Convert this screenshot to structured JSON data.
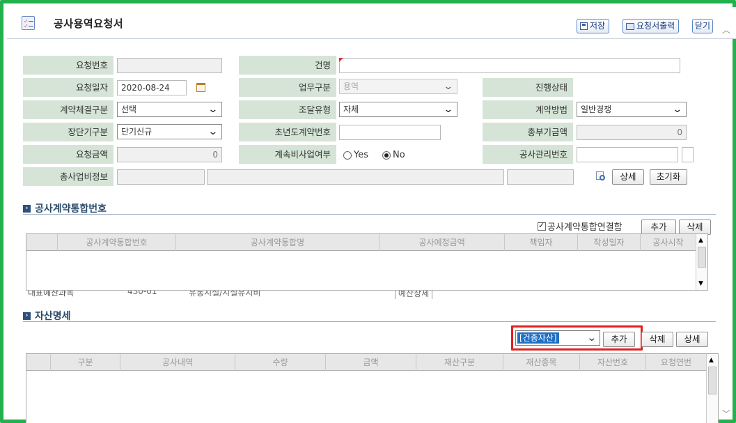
{
  "header": {
    "title": "공사용역요청서",
    "save_label": "저장",
    "print_label": "요청서출력",
    "close_label": "닫기"
  },
  "form": {
    "request_no_label": "요청번호",
    "request_no_value": "",
    "case_name_label": "건명",
    "case_name_value": "",
    "request_date_label": "요청일자",
    "request_date_value": "2020-08-24",
    "work_type_label": "업무구분",
    "work_type_value": "용역",
    "progress_label": "진행상태",
    "progress_value": "",
    "contract_method_group_label": "계약체결구분",
    "contract_method_group_value": "선택",
    "procure_type_label": "조달유형",
    "procure_type_value": "자체",
    "contract_method_label": "계약방법",
    "contract_method_value": "일반경쟁",
    "term_type_label": "장단기구분",
    "term_type_value": "단기신규",
    "first_year_no_label": "초년도계약번호",
    "first_year_no_value": "",
    "total_amount_label": "총부기금액",
    "total_amount_value": "0",
    "request_amount_label": "요청금액",
    "request_amount_value": "0",
    "continuing_label": "계속비사업여부",
    "continuing_yes": "Yes",
    "continuing_no": "No",
    "continuing_selected": "No",
    "mgmt_no_label": "공사관리번호",
    "mgmt_no_value": "",
    "budget_info_label": "총사업비정보",
    "detail_button": "상세",
    "reset_button": "초기화"
  },
  "section_contract": {
    "title": "공사계약통합번호",
    "checkbox_label": "공사계약통합연결함",
    "add_button": "추가",
    "delete_button": "삭제",
    "columns": [
      "공사계약통합번호",
      "공사계약통합명",
      "공사예정금액",
      "책임자",
      "작성일자",
      "공사시작"
    ],
    "ghost_label": "대표예산과목",
    "ghost_code": "430-01",
    "ghost_name": "유통시설/시설유지비",
    "ghost_button": "예산상세"
  },
  "section_asset": {
    "title": "자산명세",
    "asset_type_value": "[건종자산]",
    "add_button": "추가",
    "delete_button": "삭제",
    "detail_button": "상세",
    "columns": [
      "구분",
      "공사내역",
      "수량",
      "금액",
      "재산구분",
      "재산종목",
      "자산번호",
      "요청연번"
    ]
  },
  "colors": {
    "frame": "#22b14c",
    "label_bg": "#d5e4d6",
    "highlight": "#e02020",
    "selected_option": "#1f6fc4"
  }
}
